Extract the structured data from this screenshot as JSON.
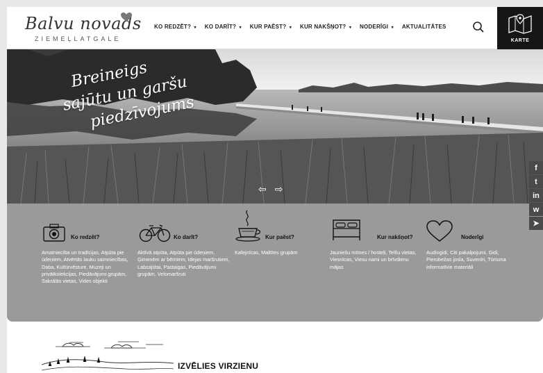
{
  "header": {
    "logo_script": "Balvu novads",
    "logo_sub": "ZIEMEĻLATGALE",
    "nav": [
      {
        "label": "KO REDZĒT?",
        "caret": "▾"
      },
      {
        "label": "KO DARĪT?",
        "caret": "▾"
      },
      {
        "label": "KUR PAĒST?",
        "caret": "▾"
      },
      {
        "label": "KUR NAKŠŅOT?",
        "caret": "▾"
      },
      {
        "label": "NODERĪGI",
        "caret": "▾"
      },
      {
        "label": "AKTUALITĀTES",
        "caret": ""
      }
    ],
    "map_label": "KARTE",
    "search_icon": "search-icon",
    "map_icon": "map-icon"
  },
  "hero": {
    "lines": [
      "Breineigs",
      "sajūtu un garšu",
      "piedzīvojums"
    ],
    "prev": "⇦",
    "next": "⇨"
  },
  "social": [
    "f",
    "t",
    "in",
    "w",
    "➤"
  ],
  "social_icons": [
    "facebook-icon",
    "twitter-icon",
    "linkedin-icon",
    "whatsapp-icon",
    "telegram-icon"
  ],
  "categories": [
    {
      "title": "Ko redzēt?",
      "icon": "camera-icon",
      "desc": "Amatniecība un tradīcijas, Atpūta pie ūdeņiem, Atvērtās lauku saimniecības, Daba, Kultūrvēsture, Muzeji un privātkolekcijas, Piedāvājumi grupām, Sakrālās vietas, Vides objekti"
    },
    {
      "title": "Ko darīt?",
      "icon": "bicycle-icon",
      "desc": "Aktīvā atpūta, Atpūta pie ūdeņiem, Ģimenēm ar bērniem, Idejas maršrutiem, Labsajūtai, Pastaigas, Piedāvājumi grupām, Velomaršruti"
    },
    {
      "title": "Kur paēst?",
      "icon": "coffee-cup-icon",
      "desc": "Kafejnīcas, Maltītes grupām"
    },
    {
      "title": "Kur nakšņot?",
      "icon": "bed-icon",
      "desc": "Jauniešu mītnes / hosteļi, Telšu vietas, Viesnīcas, Viesu nami un brīvdienu mājas"
    },
    {
      "title": "Noderīgi",
      "icon": "heart-icon",
      "desc": "Audiogidi, Citi pakalpojumi, Gidi, Pierobežas josla, Suvenīri, Tūrisma informatīvie materiāli"
    }
  ],
  "lower": {
    "title": "IZVĒLIES VIRZIENU"
  },
  "colors": {
    "panel_gray": "#9a9a9a",
    "map_button": "#161616"
  }
}
